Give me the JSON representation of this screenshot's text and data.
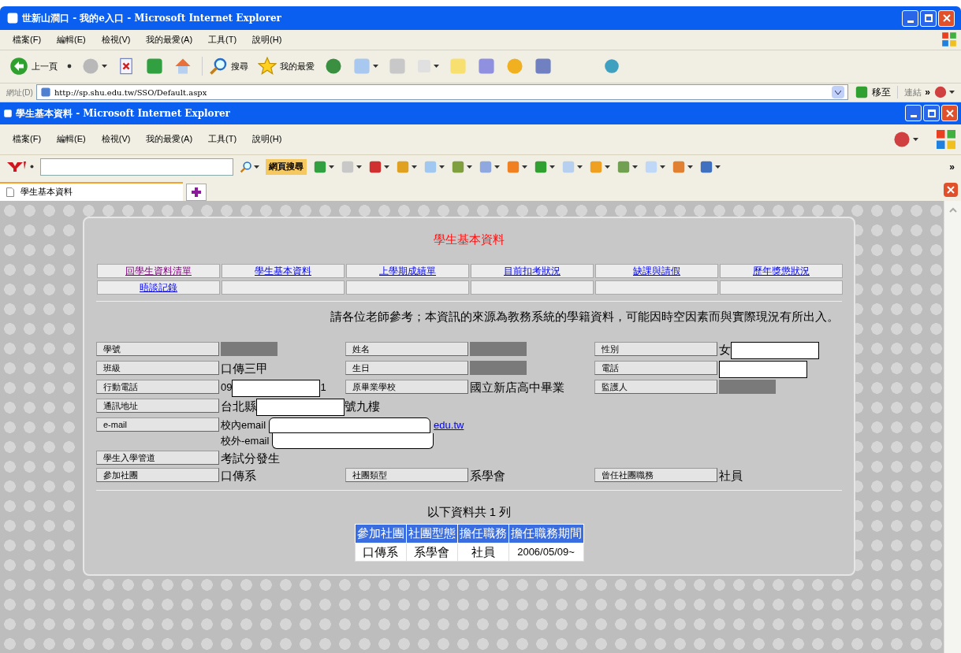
{
  "outer_window": {
    "title": "世新山澗口 - 我的e入口 - Microsoft Internet Explorer",
    "menu": [
      "檔案(F)",
      "編輯(E)",
      "檢視(V)",
      "我的最愛(A)",
      "工具(T)",
      "說明(H)"
    ],
    "toolbar": {
      "back": "上一頁",
      "search": "搜尋",
      "favorites": "我的最愛"
    },
    "address": {
      "label": "網址(D)",
      "url": "http://sp.shu.edu.tw/SSO/Default.aspx",
      "go": "移至",
      "links": "連結",
      "more": "»"
    }
  },
  "inner_window": {
    "title": "學生基本資料 - Microsoft Internet Explorer",
    "menu": [
      "檔案(F)",
      "編輯(E)",
      "檢視(V)",
      "我的最愛(A)",
      "工具(T)",
      "說明(H)"
    ],
    "yahoo_toolbar": {
      "search_button": "網頁搜尋",
      "more": "»"
    },
    "tabs": [
      {
        "label": "學生基本資料",
        "selected": true
      }
    ]
  },
  "page": {
    "title": "學生基本資料",
    "nav": [
      {
        "label": "回學生資料清單",
        "visited": true
      },
      {
        "label": "學生基本資料",
        "visited": false
      },
      {
        "label": "上學期成績單",
        "visited": false
      },
      {
        "label": "目前扣考狀況",
        "visited": false
      },
      {
        "label": "缺課與請假",
        "visited": false
      },
      {
        "label": "歷年獎懲狀況",
        "visited": false
      },
      {
        "label": "晤談記錄",
        "visited": false
      }
    ],
    "notice": "請各位老師參考；本資訊的來源為教務系統的學籍資料，可能因時空因素而與實際現況有所出入。",
    "fields": [
      {
        "label": "學號",
        "value": [
          {
            "kind": "grey_redaction"
          }
        ]
      },
      {
        "label": "姓名",
        "value": [
          {
            "kind": "grey_redaction"
          }
        ]
      },
      {
        "label": "性別",
        "value": [
          {
            "kind": "text",
            "text": "女"
          },
          {
            "kind": "white_redaction"
          }
        ]
      },
      {
        "label": "班級",
        "value": [
          {
            "kind": "text",
            "text": "口傳三甲"
          }
        ]
      },
      {
        "label": "生日",
        "value": [
          {
            "kind": "grey_redaction"
          }
        ]
      },
      {
        "label": "電話",
        "value": [
          {
            "kind": "white_redaction"
          }
        ]
      },
      {
        "label": "行動電話",
        "value": [
          {
            "kind": "small",
            "text": "09"
          },
          {
            "kind": "white_redaction"
          },
          {
            "kind": "small",
            "text": "1"
          }
        ]
      },
      {
        "label": "原畢業學校",
        "value": [
          {
            "kind": "text",
            "text": "國立新店高中畢業"
          }
        ]
      },
      {
        "label": "監護人",
        "value": [
          {
            "kind": "grey_redaction"
          }
        ]
      },
      {
        "label": "通訊地址",
        "wide": true,
        "value": [
          {
            "kind": "text",
            "text": "台北縣"
          },
          {
            "kind": "white_redaction"
          },
          {
            "kind": "text",
            "text": "號九樓"
          }
        ]
      },
      {
        "label": "e-mail",
        "wide": true,
        "value": [
          {
            "kind": "email",
            "text": "校內email",
            "link": "edu.tw"
          },
          {
            "kind": "email",
            "text": "校外-email"
          }
        ]
      },
      {
        "label": "學生入學管道",
        "wide": true,
        "value": [
          {
            "kind": "text",
            "text": "考試分發生"
          }
        ]
      },
      {
        "label": "參加社團",
        "value": [
          {
            "kind": "text",
            "text": "口傳系"
          }
        ]
      },
      {
        "label": "社團類型",
        "value": [
          {
            "kind": "text",
            "text": "系學會"
          }
        ]
      },
      {
        "label": "曾任社團職務",
        "value": [
          {
            "kind": "text",
            "text": "社員"
          }
        ]
      }
    ],
    "table_caption": "以下資料共 1 列",
    "table": {
      "columns": [
        "參加社團",
        "社團型態",
        "擔任職務",
        "擔任職務期間"
      ],
      "rows": [
        [
          "口傳系",
          "系學會",
          "社員",
          "2006/05/09~"
        ]
      ]
    }
  }
}
